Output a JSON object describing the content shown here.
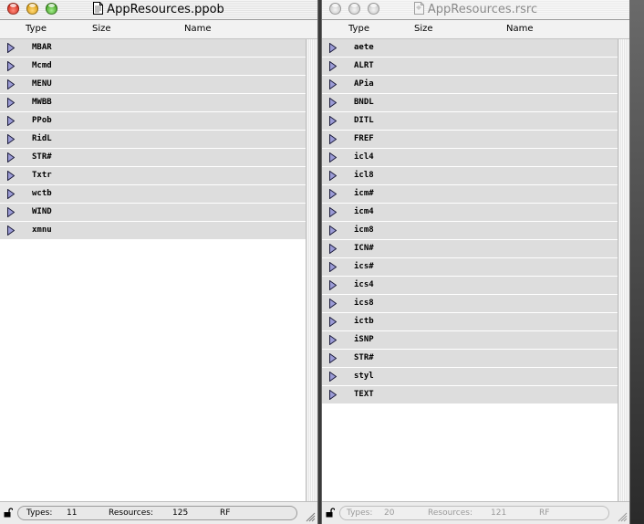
{
  "windows": [
    {
      "title": "AppResources.ppob",
      "columns": {
        "type": "Type",
        "size": "Size",
        "name": "Name"
      },
      "types": [
        "MBAR",
        "Mcmd",
        "MENU",
        "MWBB",
        "PPob",
        "RidL",
        "STR#",
        "Txtr",
        "wctb",
        "WIND",
        "xmnu"
      ],
      "status": {
        "types_label": "Types:",
        "types_count": "11",
        "resources_label": "Resources:",
        "resources_count": "125",
        "fork": "RF"
      }
    },
    {
      "title": "AppResources.rsrc",
      "columns": {
        "type": "Type",
        "size": "Size",
        "name": "Name"
      },
      "types": [
        "aete",
        "ALRT",
        "APia",
        "BNDL",
        "DITL",
        "FREF",
        "icl4",
        "icl8",
        "icm#",
        "icm4",
        "icm8",
        "ICN#",
        "ics#",
        "ics4",
        "ics8",
        "ictb",
        "iSNP",
        "STR#",
        "styl",
        "TEXT"
      ],
      "status": {
        "types_label": "Types:",
        "types_count": "20",
        "resources_label": "Resources:",
        "resources_count": "121",
        "fork": "RF"
      }
    }
  ],
  "icons": {
    "disclosure": "disclosure-triangle-icon",
    "lock": "lock-icon",
    "document": "document-icon",
    "resize": "resize-grip-icon"
  },
  "colors": {
    "row_bg": "#dddddd",
    "triangle_fill": "#9b9bd6",
    "close": "#d2291b",
    "minimize": "#d89a0c",
    "zoom": "#3c9e1c"
  }
}
